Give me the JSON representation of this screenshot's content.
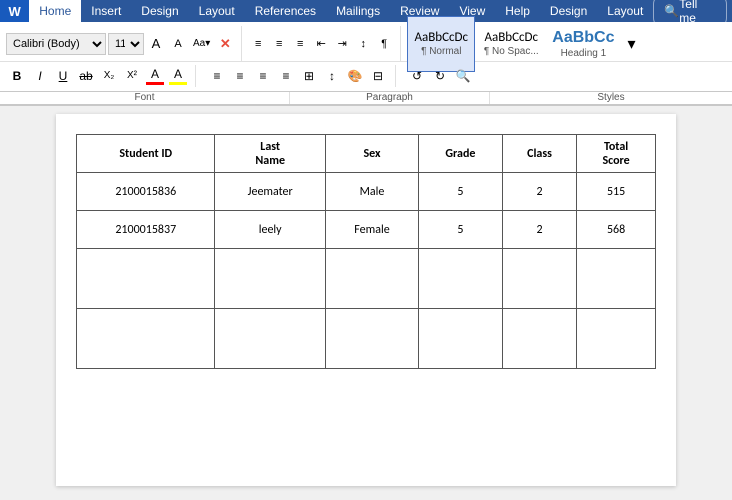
{
  "menubar": {
    "tabs": [
      "Home",
      "Insert",
      "Design",
      "Layout",
      "References",
      "Mailings",
      "Review",
      "View",
      "Help",
      "Design",
      "Layout"
    ],
    "active_tab": "Home",
    "tell_me_label": "Tell me",
    "tell_me_placeholder": "Tell me what you want to do"
  },
  "ribbon": {
    "font_family": "Calibri (Body)",
    "font_size": "11",
    "format_buttons": [
      "B",
      "I",
      "U",
      "ab",
      "X₂",
      "X²"
    ],
    "font_color_label": "A",
    "highlight_color_label": "A",
    "paragraph_buttons": [
      "≡",
      "≡",
      "≡"
    ],
    "para_mark": "¶",
    "styles": [
      {
        "id": "normal",
        "preview": "AaBbCcDc",
        "label": "¶ Normal",
        "active": true
      },
      {
        "id": "no-space",
        "preview": "AaBbCcDc",
        "label": "¶ No Spac...",
        "active": false
      },
      {
        "id": "heading1",
        "preview": "AaBbCc",
        "label": "Heading 1",
        "active": false
      }
    ],
    "font_group_label": "Font",
    "paragraph_group_label": "Paragraph",
    "styles_group_label": "Styles"
  },
  "table": {
    "headers": [
      "Student ID",
      "Last\nName",
      "Sex",
      "Grade",
      "Class",
      "Total\nScore"
    ],
    "rows": [
      {
        "student_id": "2100015836",
        "last_name": "Jeemater",
        "sex": "Male",
        "grade": "5",
        "class": "2",
        "total_score": "515"
      },
      {
        "student_id": "2100015837",
        "last_name": "leely",
        "sex": "Female",
        "grade": "5",
        "class": "2",
        "total_score": "568"
      },
      {
        "student_id": "",
        "last_name": "",
        "sex": "",
        "grade": "",
        "class": "",
        "total_score": ""
      },
      {
        "student_id": "",
        "last_name": "",
        "sex": "",
        "grade": "",
        "class": "",
        "total_score": ""
      }
    ]
  }
}
